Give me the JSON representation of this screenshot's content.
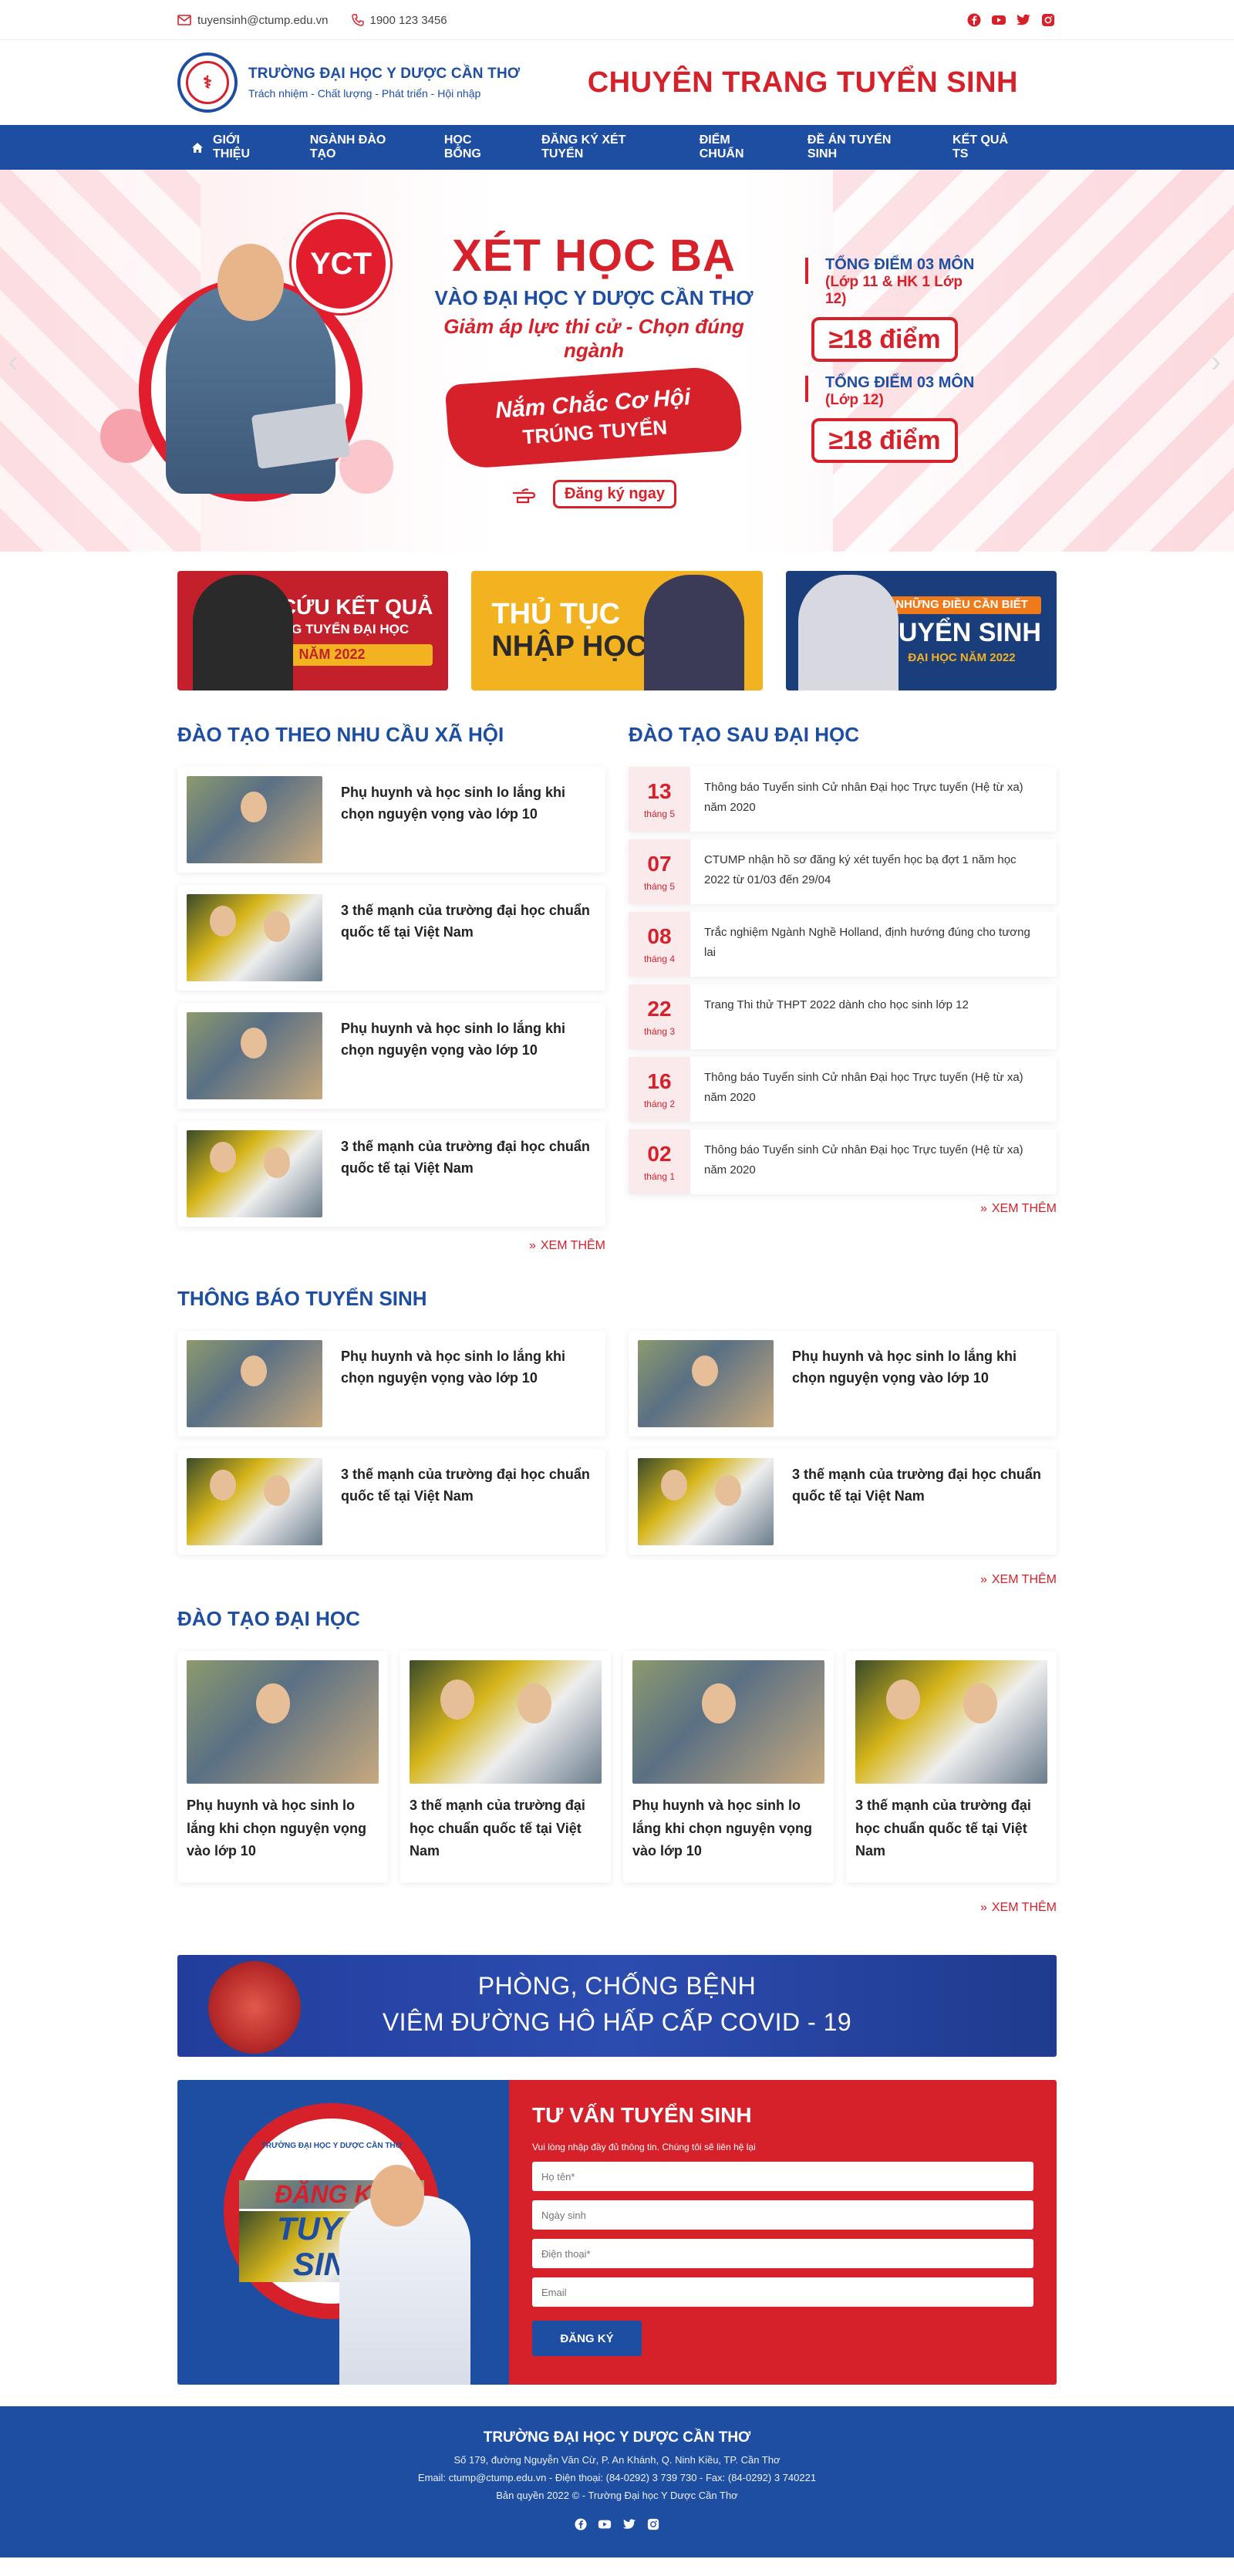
{
  "topbar": {
    "email": "tuyensinh@ctump.edu.vn",
    "phone": "1900 123 3456",
    "socials": [
      "facebook-icon",
      "youtube-icon",
      "twitter-icon",
      "instagram-icon"
    ]
  },
  "header": {
    "school_name": "TRƯỜNG ĐẠI HỌC Y DƯỢC CẦN THƠ",
    "slogan": "Trách nhiệm - Chất lượng - Phát triển - Hội nhập",
    "site_title": "CHUYÊN TRANG TUYỂN SINH",
    "brand_color": "#1e4ea1",
    "accent_color": "#d6202a"
  },
  "nav": {
    "items": [
      "GIỚI THIỆU",
      "NGÀNH ĐÀO TẠO",
      "HỌC BỔNG",
      "ĐĂNG KÝ XÉT TUYỂN",
      "ĐIỂM CHUẨN",
      "ĐỀ ÁN TUYỂN SINH",
      "KẾT QUẢ TS"
    ]
  },
  "hero": {
    "badge": "YCT",
    "title": "XÉT HỌC BẠ",
    "subtitle": "VÀO ĐẠI HỌC Y DƯỢC CẦN THƠ",
    "tagline": "Giảm áp lực thi cử - Chọn đúng ngành",
    "brush_line1": "Nắm Chắc Cơ Hội",
    "brush_line2": "TRÚNG TUYỂN",
    "register": "Đăng ký ngay",
    "score1_label": "TỔNG ĐIỂM 03 MÔN",
    "score1_sub": "(Lớp 11 & HK 1 Lớp 12)",
    "score1_value": "≥18 điểm",
    "score2_label": "TỔNG ĐIỂM 03 MÔN",
    "score2_sub": "(Lớp 12)",
    "score2_value": "≥18 điểm"
  },
  "promos": [
    {
      "line1": "TRA CỨU KẾT QUẢ",
      "line2": "TRÚNG TUYỂN ĐẠI HỌC",
      "line3": "NĂM 2022"
    },
    {
      "line1": "THỦ TỤC",
      "line2": "NHẬP HỌC"
    },
    {
      "line1": "NHỮNG ĐIỀU CẦN BIẾT",
      "line2": "TUYỂN SINH",
      "line3": "ĐẠI HỌC NĂM 2022"
    }
  ],
  "social_training": {
    "title": "ĐÀO TẠO THEO NHU CẦU XÃ HỘI",
    "items": [
      "Phụ huynh và học sinh lo lắng khi chọn nguyện vọng vào lớp 10",
      "3 thế mạnh của trường đại học chuẩn quốc tế tại Việt Nam",
      "Phụ huynh và học sinh lo lắng khi chọn nguyện vọng vào lớp 10",
      "3 thế mạnh của trường đại học chuẩn quốc tế tại Việt Nam"
    ],
    "more": "XEM THÊM"
  },
  "postgrad": {
    "title": "ĐÀO TẠO SAU ĐẠI HỌC",
    "events": [
      {
        "day": "13",
        "month": "tháng 5",
        "text": "Thông báo Tuyển sinh Cử nhân Đại học Trực tuyến (Hệ từ xa) năm 2020"
      },
      {
        "day": "07",
        "month": "tháng 5",
        "text": "CTUMP nhận hồ sơ đăng ký xét tuyển học bạ đợt 1 năm học 2022 từ 01/03 đến 29/04"
      },
      {
        "day": "08",
        "month": "tháng 4",
        "text": "Trắc nghiệm Ngành Nghề Holland, định hướng đúng cho tương lai"
      },
      {
        "day": "22",
        "month": "tháng 3",
        "text": "Trang Thi thử THPT 2022 dành cho học sinh lớp 12"
      },
      {
        "day": "16",
        "month": "tháng 2",
        "text": "Thông báo Tuyển sinh Cử nhân Đại học Trực tuyến (Hệ từ xa) năm 2020"
      },
      {
        "day": "02",
        "month": "tháng 1",
        "text": "Thông báo Tuyển sinh Cử nhân Đại học Trực tuyến (Hệ từ xa) năm 2020"
      }
    ],
    "more": "XEM THÊM"
  },
  "notices": {
    "title": "THÔNG BÁO TUYỂN SINH",
    "items": [
      "Phụ huynh và học sinh lo lắng khi chọn nguyện vọng vào lớp 10",
      "Phụ huynh và học sinh lo lắng khi chọn nguyện vọng vào lớp 10",
      "3 thế mạnh của trường đại học chuẩn quốc tế tại Việt Nam",
      "3 thế mạnh của trường đại học chuẩn quốc tế tại Việt Nam"
    ],
    "more": "XEM THÊM"
  },
  "undergrad": {
    "title": "ĐÀO TẠO ĐẠI HỌC",
    "items": [
      "Phụ huynh và học sinh lo lắng khi chọn nguyện vọng vào lớp 10",
      "3 thế mạnh của trường đại học chuẩn quốc tế tại Việt Nam",
      "Phụ huynh và học sinh lo lắng khi chọn nguyện vọng vào lớp 10",
      "3 thế mạnh của trường đại học chuẩn quốc tế tại Việt Nam"
    ],
    "more": "XEM THÊM"
  },
  "covid": {
    "line1": "PHÒNG, CHỐNG BỆNH",
    "line2": "VIÊM ĐƯỜNG HÔ HẤP CẤP COVID - 19"
  },
  "consult": {
    "logo_text": "TRƯỜNG ĐẠI HỌC Y DƯỢC CẦN THƠ",
    "badge1": "ĐĂNG KÝ",
    "badge2": "TUYỂN",
    "badge3": "SINH",
    "title": "TƯ VẤN TUYỂN SINH",
    "hint": "Vui lòng nhập đầy đủ thông tin. Chúng tôi sẽ liên hệ lại",
    "placeholders": {
      "name": "Họ tên*",
      "dob": "Ngày sinh",
      "phone": "Điện thoại*",
      "email": "Email"
    },
    "submit": "ĐĂNG KÝ"
  },
  "footer": {
    "name": "TRƯỜNG ĐẠI HỌC Y DƯỢC CẦN THƠ",
    "address": "Số 179, đường Nguyễn Văn Cừ, P. An Khánh, Q. Ninh Kiều, TP. Cần Thơ",
    "contact": "Email: ctump@ctump.edu.vn  -  Điện thoại: (84-0292) 3 739 730  - Fax: (84-0292) 3 740221",
    "copyright": "Bản quyền 2022 © - Trường Đại học Y Dược Cần Thơ"
  }
}
